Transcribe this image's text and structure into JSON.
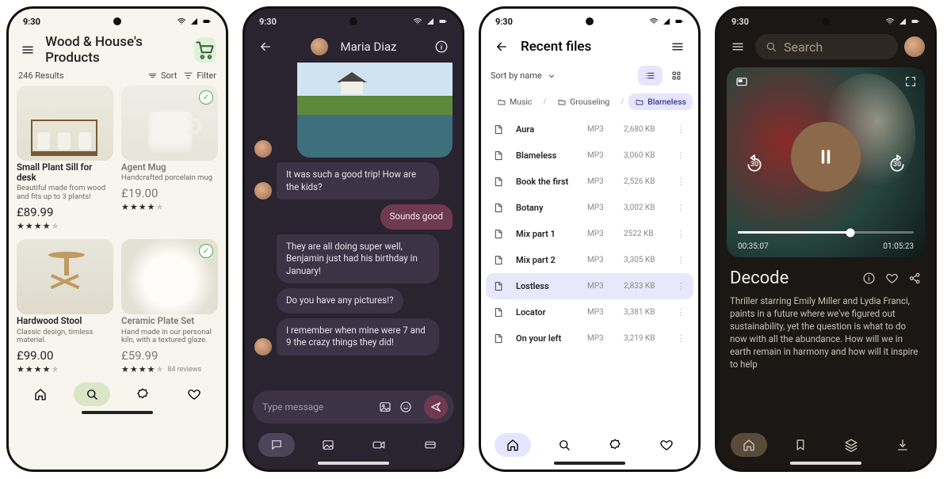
{
  "status_time": "9:30",
  "shop": {
    "title": "Wood & House's Products",
    "results_label": "246 Results",
    "sort_label": "Sort",
    "filter_label": "Filter",
    "products": [
      {
        "name": "Small Plant Sill for desk",
        "desc": "Beautiful made from wood and fits up to 3 plants!",
        "price": "£89.99",
        "rating": 4.5,
        "verified": false
      },
      {
        "name": "Agent Mug",
        "desc": "Handcrafted porcelain mug",
        "price": "£19.00",
        "rating": 4.5,
        "verified": true
      },
      {
        "name": "Hardwood Stool",
        "desc": "Classic design, timless material.",
        "price": "£99.00",
        "rating": 4.5,
        "verified": false
      },
      {
        "name": "Ceramic Plate Set",
        "desc": "Hand made in our personal kiln, with a textured glaze.",
        "price": "£59.99",
        "rating": 4.5,
        "verified": true,
        "reviews_label": "84 reviews"
      }
    ]
  },
  "chat": {
    "contact_name": "Maria Diaz",
    "messages": [
      {
        "dir": "in",
        "text": "It was such a good trip! How are the kids?",
        "show_avatar": true,
        "first": true,
        "last": true
      },
      {
        "dir": "out",
        "text": "Sounds good"
      },
      {
        "dir": "in",
        "text": "They are all doing super well, Benjamin just had his birthday in January!",
        "first": true
      },
      {
        "dir": "in",
        "text": "Do you have any pictures!?"
      },
      {
        "dir": "in",
        "text": "I remember when mine were 7 and 9 the crazy things they did!",
        "show_avatar": true,
        "last": true
      }
    ],
    "input_placeholder": "Type message"
  },
  "files": {
    "title": "Recent files",
    "sort_label": "Sort by name",
    "breadcrumbs": [
      "Music",
      "Grouseling",
      "Blameless"
    ],
    "rows": [
      {
        "name": "Aura",
        "type": "MP3",
        "size": "2,680 KB"
      },
      {
        "name": "Blameless",
        "type": "MP3",
        "size": "3,060 KB"
      },
      {
        "name": "Book the first",
        "type": "MP3",
        "size": "2,526 KB"
      },
      {
        "name": "Botany",
        "type": "MP3",
        "size": "3,002 KB"
      },
      {
        "name": "Mix part 1",
        "type": "MP3",
        "size": "2522 KB"
      },
      {
        "name": "Mix part 2",
        "type": "MP3",
        "size": "3,305 KB"
      },
      {
        "name": "Lostless",
        "type": "MP3",
        "size": "2,833 KB",
        "selected": true
      },
      {
        "name": "Locator",
        "type": "MP3",
        "size": "3,381 KB"
      },
      {
        "name": "On your left",
        "type": "MP3",
        "size": "3,219 KB"
      }
    ]
  },
  "media": {
    "search_placeholder": "Search",
    "skip_secs": "30",
    "elapsed": "00:35:07",
    "total": "01:05:23",
    "title": "Decode",
    "description": "Thriller starring Emily Miller and Lydia Franci, paints in a future where we've figured out sustainability, yet the question is what to do now with all the abundance. How will we in earth remain in harmony and how will it inspire to help"
  }
}
